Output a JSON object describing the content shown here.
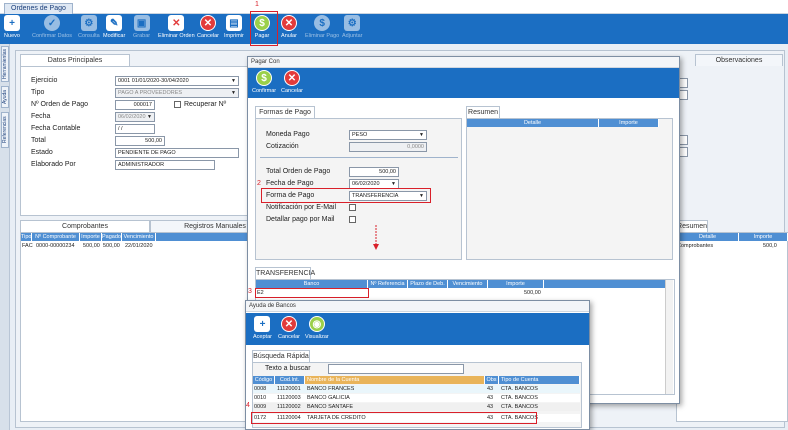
{
  "window": {
    "tab_title": "Ordenes de Pago"
  },
  "toolbar": {
    "buttons": [
      {
        "label": "Nuevo",
        "glyph": "+"
      },
      {
        "label": "Confirmar Datos",
        "glyph": "✓"
      },
      {
        "label": "Consulta",
        "glyph": "⚙"
      },
      {
        "label": "Modificar",
        "glyph": "✎"
      },
      {
        "label": "Grabar",
        "glyph": "▣"
      },
      {
        "label": "Eliminar Orden",
        "glyph": "✕"
      },
      {
        "label": "Cancelar",
        "glyph": "✕"
      },
      {
        "label": "Imprimir",
        "glyph": "▤"
      },
      {
        "label": "Pagar",
        "glyph": "$"
      },
      {
        "label": "Anular",
        "glyph": "✕"
      },
      {
        "label": "Eliminar Pago",
        "glyph": "$"
      },
      {
        "label": "Adjuntar",
        "glyph": "⚙"
      }
    ]
  },
  "annotations": {
    "n1": "1",
    "n2": "2",
    "n3": "3",
    "n4": "4"
  },
  "sidetabs": [
    "Herramientas",
    "Ayuda",
    "Referencias"
  ],
  "main": {
    "datos_tab": "Datos Principales",
    "observaciones_tab": "Observaciones",
    "fields": {
      "ejercicio_label": "Ejercicio",
      "ejercicio_value": "0001 01/01/2020-30/04/2020",
      "tipo_label": "Tipo",
      "tipo_value": "PAGO A PROVEEDORES",
      "orden_label": "Nº Orden de Pago",
      "orden_value": "000017",
      "recuperar_label": "Recuperar Nº",
      "fecha_label": "Fecha",
      "fecha_value": "06/02/2020",
      "fecha_contable_label": "Fecha Contable",
      "fecha_contable_value": "/  /",
      "total_label": "Total",
      "total_value": "500,00",
      "estado_label": "Estado",
      "estado_value": "PENDIENTE DE PAGO",
      "elaborado_label": "Elaborado Por",
      "elaborado_value": "ADMINISTRADOR"
    },
    "comprobantes_tab": "Comprobantes",
    "registros_tab": "Registros Manuales",
    "comprobantes_cols": [
      "Tipo",
      "Nº Comprobante",
      "Importe",
      "Pagado",
      "Vencimiento"
    ],
    "comprobantes_rows": [
      [
        "FAC",
        "0000-00000234",
        "500,00",
        "500,00",
        "22/01/2020"
      ]
    ],
    "resumen_tab": "Resumen",
    "resumen_cols": [
      "Detalle",
      "Importe"
    ],
    "resumen_rows": [
      [
        "Comprobantes",
        "500,0"
      ]
    ]
  },
  "pagar_dialog": {
    "title": "Pagar Con",
    "confirmar": "Confirmar",
    "cancelar": "Cancelar",
    "formas_tab": "Formas de Pago",
    "resumen_tab": "Resumen",
    "resumen_cols": [
      "Detalle",
      "Importe"
    ],
    "moneda_label": "Moneda Pago",
    "moneda_value": "PESO",
    "cotizacion_label": "Cotización",
    "cotizacion_value": "0,0000",
    "total_label": "Total Orden de Pago",
    "total_value": "500,00",
    "fecha_label": "Fecha de Pago",
    "fecha_value": "06/02/2020",
    "forma_label": "Forma de Pago",
    "forma_value": "TRANSFERENCIA",
    "notif_label": "Notificación por E-Mail",
    "detallar_label": "Detallar pago por Mail",
    "transfer_tab": "TRANSFERENCIA",
    "transfer_cols": [
      "Banco",
      "Nº Referencia",
      "Plazo de Deb.",
      "Vencimiento",
      "Importe"
    ],
    "transfer_row": {
      "banco": "E2",
      "importe": "500,00"
    }
  },
  "bancos_dialog": {
    "title": "Ayuda de Bancos",
    "aceptar": "Aceptar",
    "cancelar": "Cancelar",
    "visualizar": "Visualizar",
    "busqueda_tab": "Búsqueda Rápida",
    "texto_label": "Texto a buscar",
    "cols": [
      "Código",
      "Cod.Int.",
      "Nombre de la Cuenta",
      "Obs",
      "Tipo de Cuenta"
    ],
    "rows": [
      [
        "0008",
        "11120001",
        "BANCO FRANCES",
        "43",
        "CTA. BANCOS"
      ],
      [
        "0010",
        "11120003",
        "BANCO GALICIA",
        "43",
        "CTA. BANCOS"
      ],
      [
        "0009",
        "11120002",
        "BANCO SANTAFE",
        "43",
        "CTA. BANCOS"
      ],
      [
        "0172",
        "11120004",
        "TARJETA DE CREDITO",
        "43",
        "CTA. BANCOS"
      ]
    ]
  },
  "colors": {
    "accent": "#1b6ec2",
    "grid_header": "#4f8fd3",
    "highlight": "#d9202a"
  }
}
